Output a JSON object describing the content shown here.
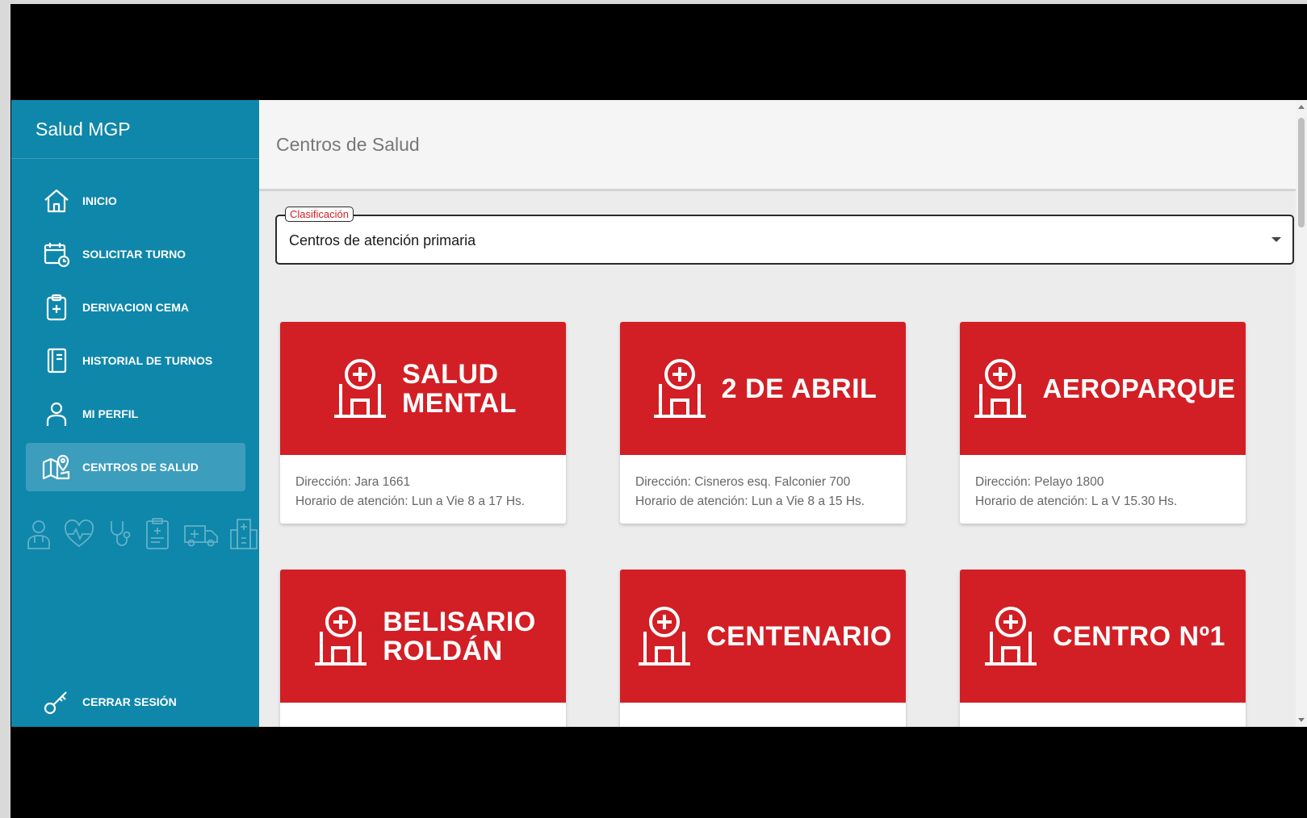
{
  "sidebar": {
    "brand": "Salud MGP",
    "items": [
      {
        "label": "INICIO",
        "icon": "home-icon",
        "name": "sidebar-item-inicio"
      },
      {
        "label": "SOLICITAR TURNO",
        "icon": "calendar-clock-icon",
        "name": "sidebar-item-solicitar-turno"
      },
      {
        "label": "DERIVACION CEMA",
        "icon": "clipboard-plus-icon",
        "name": "sidebar-item-derivacion-cema"
      },
      {
        "label": "HISTORIAL DE TURNOS",
        "icon": "book-icon",
        "name": "sidebar-item-historial-de-turnos"
      },
      {
        "label": "MI PERFIL",
        "icon": "user-icon",
        "name": "sidebar-item-mi-perfil"
      },
      {
        "label": "CENTROS DE SALUD",
        "icon": "map-pin-icon",
        "name": "sidebar-item-centros-de-salud",
        "active": true
      }
    ],
    "decorative_icons": [
      "doctor-icon",
      "heartbeat-icon",
      "stethoscope-icon",
      "medical-clipboard-icon",
      "ambulance-icon",
      "hospital-building-icon"
    ],
    "logout_label": "CERRAR SESIÓN"
  },
  "main": {
    "title": "Centros de Salud",
    "select": {
      "legend": "Clasificación",
      "value": "Centros de atención primaria"
    },
    "cards": [
      {
        "name": "SALUD\nMENTAL",
        "address": "Dirección: Jara 1661",
        "hours": "Horario de atención: Lun a Vie 8 a 17 Hs."
      },
      {
        "name": "2 DE ABRIL",
        "address": "Dirección: Cisneros esq. Falconier 700",
        "hours": "Horario de atención: Lun a Vie 8 a 15 Hs."
      },
      {
        "name": "AEROPARQUE",
        "address": "Dirección: Pelayo 1800",
        "hours": "Horario de atención: L a V 15.30 Hs."
      },
      {
        "name": "BELISARIO\nROLDÁN",
        "address": "",
        "hours": ""
      },
      {
        "name": "CENTENARIO",
        "address": "",
        "hours": ""
      },
      {
        "name": "CENTRO Nº1",
        "address": "",
        "hours": ""
      }
    ]
  },
  "colors": {
    "sidebar": "#0f87ab",
    "sidebar_active": "#3c9dbd",
    "card_red": "#d21f25",
    "background": "#ececec"
  }
}
